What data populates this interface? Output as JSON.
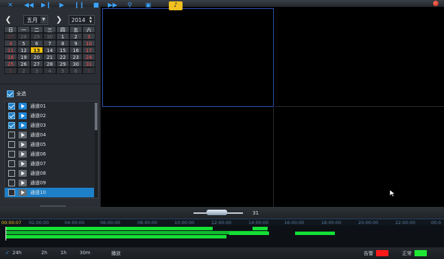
{
  "calendar": {
    "month": "五月",
    "year": "2014",
    "weekdays": [
      "日",
      "一",
      "二",
      "三",
      "四",
      "五",
      "六"
    ],
    "weeks": [
      [
        "27",
        "28",
        "29",
        "30",
        "1",
        "2",
        "3"
      ],
      [
        "4",
        "5",
        "6",
        "7",
        "8",
        "9",
        "10"
      ],
      [
        "11",
        "12",
        "13",
        "14",
        "15",
        "16",
        "17"
      ],
      [
        "18",
        "19",
        "20",
        "21",
        "22",
        "23",
        "24"
      ],
      [
        "25",
        "26",
        "27",
        "28",
        "29",
        "30",
        "31"
      ],
      [
        "1",
        "2",
        "3",
        "4",
        "5",
        "6",
        "7"
      ]
    ],
    "selected_day": "13"
  },
  "channels": {
    "select_all_label": "全选",
    "items": [
      {
        "label": "通道01",
        "checked": true
      },
      {
        "label": "通道02",
        "checked": true
      },
      {
        "label": "通道03",
        "checked": true
      },
      {
        "label": "通道04",
        "checked": false
      },
      {
        "label": "通道05",
        "checked": false
      },
      {
        "label": "通道06",
        "checked": false
      },
      {
        "label": "通道07",
        "checked": false
      },
      {
        "label": "通道08",
        "checked": false
      },
      {
        "label": "通道09",
        "checked": false
      },
      {
        "label": "通道10",
        "checked": false
      }
    ]
  },
  "toolbar": {
    "speed_value": "31"
  },
  "timeline": {
    "current_time": "00:00:07",
    "ticks": [
      "02:00:00",
      "04:00:00",
      "06:00:00",
      "08:00:00",
      "10:00:00",
      "12:00:00",
      "14:00:00",
      "16:00:00",
      "18:00:00",
      "20:00:00",
      "22:00:00",
      "00:0"
    ]
  },
  "bottombar": {
    "zoom_options": [
      "24h",
      "2h",
      "1h",
      "30m"
    ],
    "extra_label": "播放",
    "alarm_label": "告警",
    "alarm_color": "#ff1a1a",
    "normal_label": "正常",
    "normal_color": "#1ee833"
  }
}
